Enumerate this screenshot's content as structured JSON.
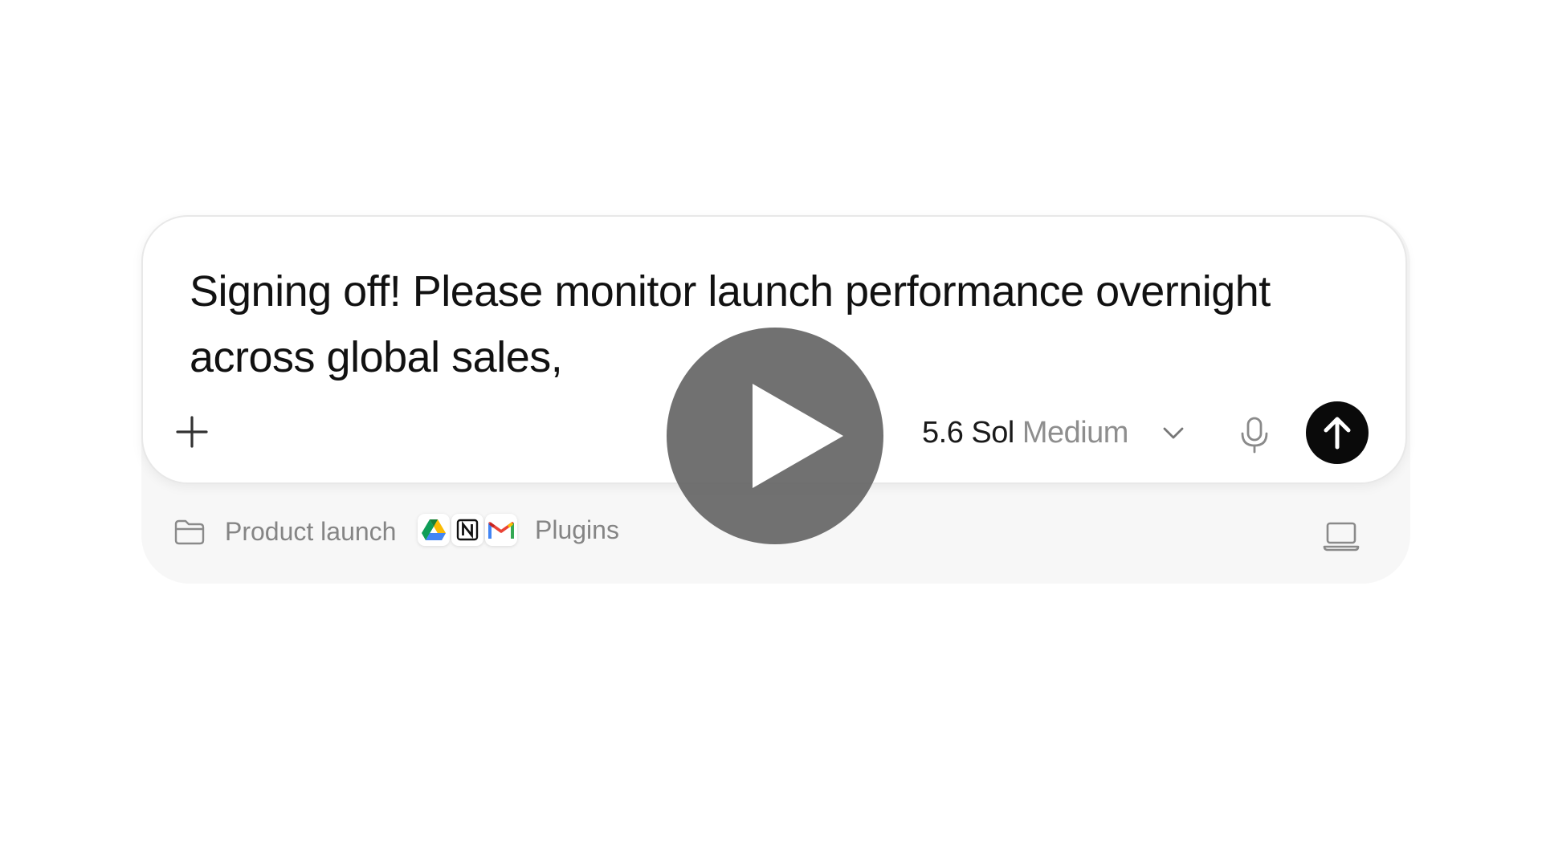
{
  "composer": {
    "prompt_text": "Signing off! Please monitor launch performance overnight across global sales,",
    "add_icon": "plus-icon",
    "model": {
      "name": "5.6 Sol",
      "tier": "Medium",
      "dropdown_icon": "chevron-down-icon"
    },
    "mic_icon": "microphone-icon",
    "send_icon": "arrow-up-icon",
    "send_color": "#0a0a0a"
  },
  "tray": {
    "project": {
      "icon": "folder-icon",
      "label": "Product launch"
    },
    "plugins": {
      "icons": [
        "google-drive-icon",
        "notion-icon",
        "gmail-icon"
      ],
      "label": "Plugins"
    },
    "device_icon": "laptop-icon"
  },
  "overlay": {
    "icon": "play-icon"
  }
}
